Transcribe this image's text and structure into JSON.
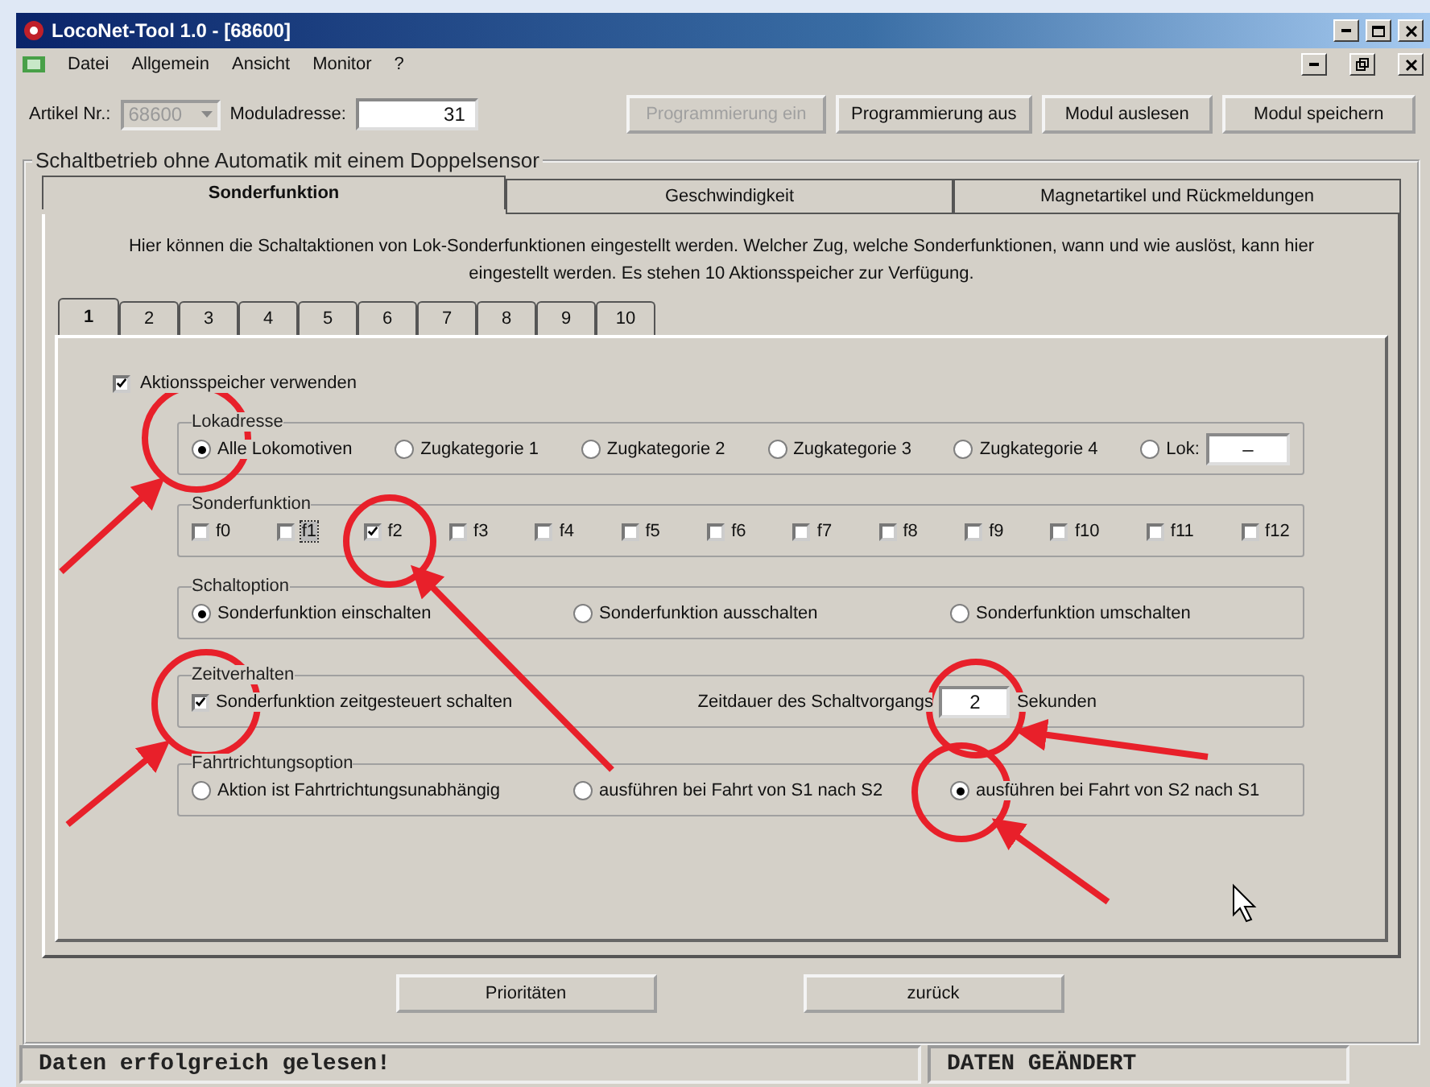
{
  "window": {
    "title": "LocoNet-Tool 1.0 - [68600]"
  },
  "menu": [
    {
      "label": "Datei"
    },
    {
      "label": "Allgemein"
    },
    {
      "label": "Ansicht"
    },
    {
      "label": "Monitor"
    },
    {
      "label": "?"
    }
  ],
  "toolbar": {
    "article_label": "Artikel Nr.:",
    "article_value": "68600",
    "address_label": "Moduladresse:",
    "address_value": "31",
    "buttons": [
      {
        "label": "Programmierung ein",
        "disabled": true
      },
      {
        "label": "Programmierung aus",
        "disabled": false
      },
      {
        "label": "Modul auslesen",
        "disabled": false
      },
      {
        "label": "Modul speichern",
        "disabled": false
      }
    ]
  },
  "group_title": "Schaltbetrieb ohne Automatik mit einem Doppelsensor",
  "main_tabs": [
    {
      "label": "Sonderfunktion",
      "selected": true
    },
    {
      "label": "Geschwindigkeit",
      "selected": false
    },
    {
      "label": "Magnetartikel und Rückmeldungen",
      "selected": false
    }
  ],
  "description": "Hier können die Schaltaktionen von Lok-Sonderfunktionen eingestellt werden. Welcher Zug, welche Sonderfunktionen, wann und wie auslöst, kann hier eingestellt werden. Es stehen 10 Aktionsspeicher zur Verfügung.",
  "memory_tabs": [
    {
      "label": "1",
      "selected": true
    },
    {
      "label": "2",
      "selected": false
    },
    {
      "label": "3",
      "selected": false
    },
    {
      "label": "4",
      "selected": false
    },
    {
      "label": "5",
      "selected": false
    },
    {
      "label": "6",
      "selected": false
    },
    {
      "label": "7",
      "selected": false
    },
    {
      "label": "8",
      "selected": false
    },
    {
      "label": "9",
      "selected": false
    },
    {
      "label": "10",
      "selected": false
    }
  ],
  "use_memory": {
    "label": "Aktionsspeicher verwenden",
    "checked": true
  },
  "lokadresse": {
    "title": "Lokadresse",
    "options": [
      {
        "label": "Alle Lokomotiven",
        "selected": true
      },
      {
        "label": "Zugkategorie 1",
        "selected": false
      },
      {
        "label": "Zugkategorie 2",
        "selected": false
      },
      {
        "label": "Zugkategorie 3",
        "selected": false
      },
      {
        "label": "Zugkategorie 4",
        "selected": false
      },
      {
        "label": "Lok:",
        "selected": false
      }
    ],
    "lok_value": "–"
  },
  "sonderfunktion": {
    "title": "Sonderfunktion",
    "functions": [
      {
        "label": "f0",
        "checked": false,
        "focused": false
      },
      {
        "label": "f1",
        "checked": false,
        "focused": true
      },
      {
        "label": "f2",
        "checked": true,
        "focused": false
      },
      {
        "label": "f3",
        "checked": false,
        "focused": false
      },
      {
        "label": "f4",
        "checked": false,
        "focused": false
      },
      {
        "label": "f5",
        "checked": false,
        "focused": false
      },
      {
        "label": "f6",
        "checked": false,
        "focused": false
      },
      {
        "label": "f7",
        "checked": false,
        "focused": false
      },
      {
        "label": "f8",
        "checked": false,
        "focused": false
      },
      {
        "label": "f9",
        "checked": false,
        "focused": false
      },
      {
        "label": "f10",
        "checked": false,
        "focused": false
      },
      {
        "label": "f11",
        "checked": false,
        "focused": false
      },
      {
        "label": "f12",
        "checked": false,
        "focused": false
      }
    ]
  },
  "schaltoption": {
    "title": "Schaltoption",
    "options": [
      {
        "label": "Sonderfunktion einschalten",
        "selected": true
      },
      {
        "label": "Sonderfunktion ausschalten",
        "selected": false
      },
      {
        "label": "Sonderfunktion umschalten",
        "selected": false
      }
    ]
  },
  "zeitverhalten": {
    "title": "Zeitverhalten",
    "checkbox": {
      "label": "Sonderfunktion zeitgesteuert schalten",
      "checked": true
    },
    "duration_label": "Zeitdauer des Schaltvorgangs",
    "duration_value": "2",
    "unit": "Sekunden"
  },
  "fahrtrichtung": {
    "title": "Fahrtrichtungsoption",
    "options": [
      {
        "label": "Aktion ist Fahrtrichtungsunabhängig",
        "selected": false
      },
      {
        "label": "ausführen bei Fahrt von S1 nach S2",
        "selected": false
      },
      {
        "label": "ausführen bei Fahrt von S2 nach S1",
        "selected": true
      }
    ]
  },
  "bottom_buttons": [
    {
      "label": "Prioritäten"
    },
    {
      "label": "zurück"
    }
  ],
  "status_bar": {
    "message": "Daten erfolgreich gelesen!",
    "state": "DATEN GEÄNDERT"
  }
}
